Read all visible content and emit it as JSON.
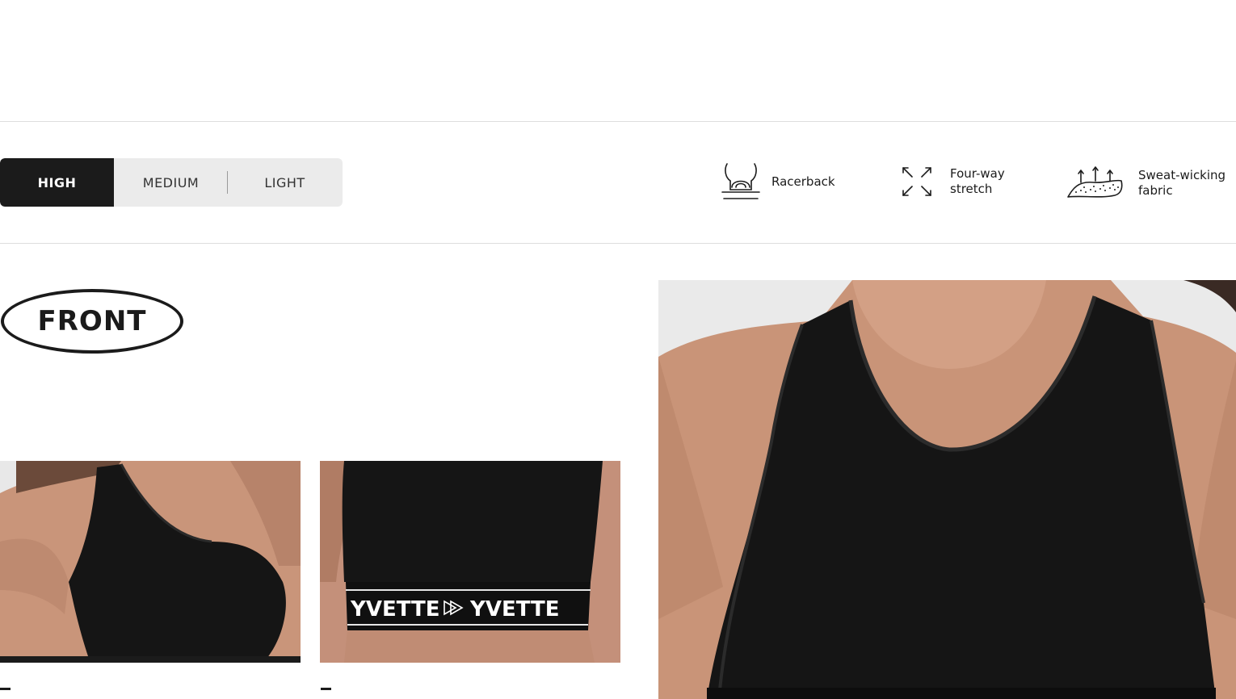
{
  "intensity_tabs": [
    {
      "label": "HIGH",
      "active": true
    },
    {
      "label": "MEDIUM",
      "active": false
    },
    {
      "label": "LIGHT",
      "active": false
    }
  ],
  "features": [
    {
      "icon": "racerback-icon",
      "label": "Racerback"
    },
    {
      "icon": "four-way-stretch-icon",
      "label": "Four-way\nstretch"
    },
    {
      "icon": "sweat-wicking-icon",
      "label": "Sweat-wicking\nfabric"
    }
  ],
  "section": {
    "title": "FRONT"
  },
  "gallery": {
    "band_brand": "YVETTE",
    "captions": [
      "-",
      "-"
    ]
  },
  "colors": {
    "accent": "#1b1b1b",
    "tab_bg": "#ebebeb",
    "photo_bg": "#eaeaea",
    "skin": "#c99478",
    "garment": "#151515"
  }
}
